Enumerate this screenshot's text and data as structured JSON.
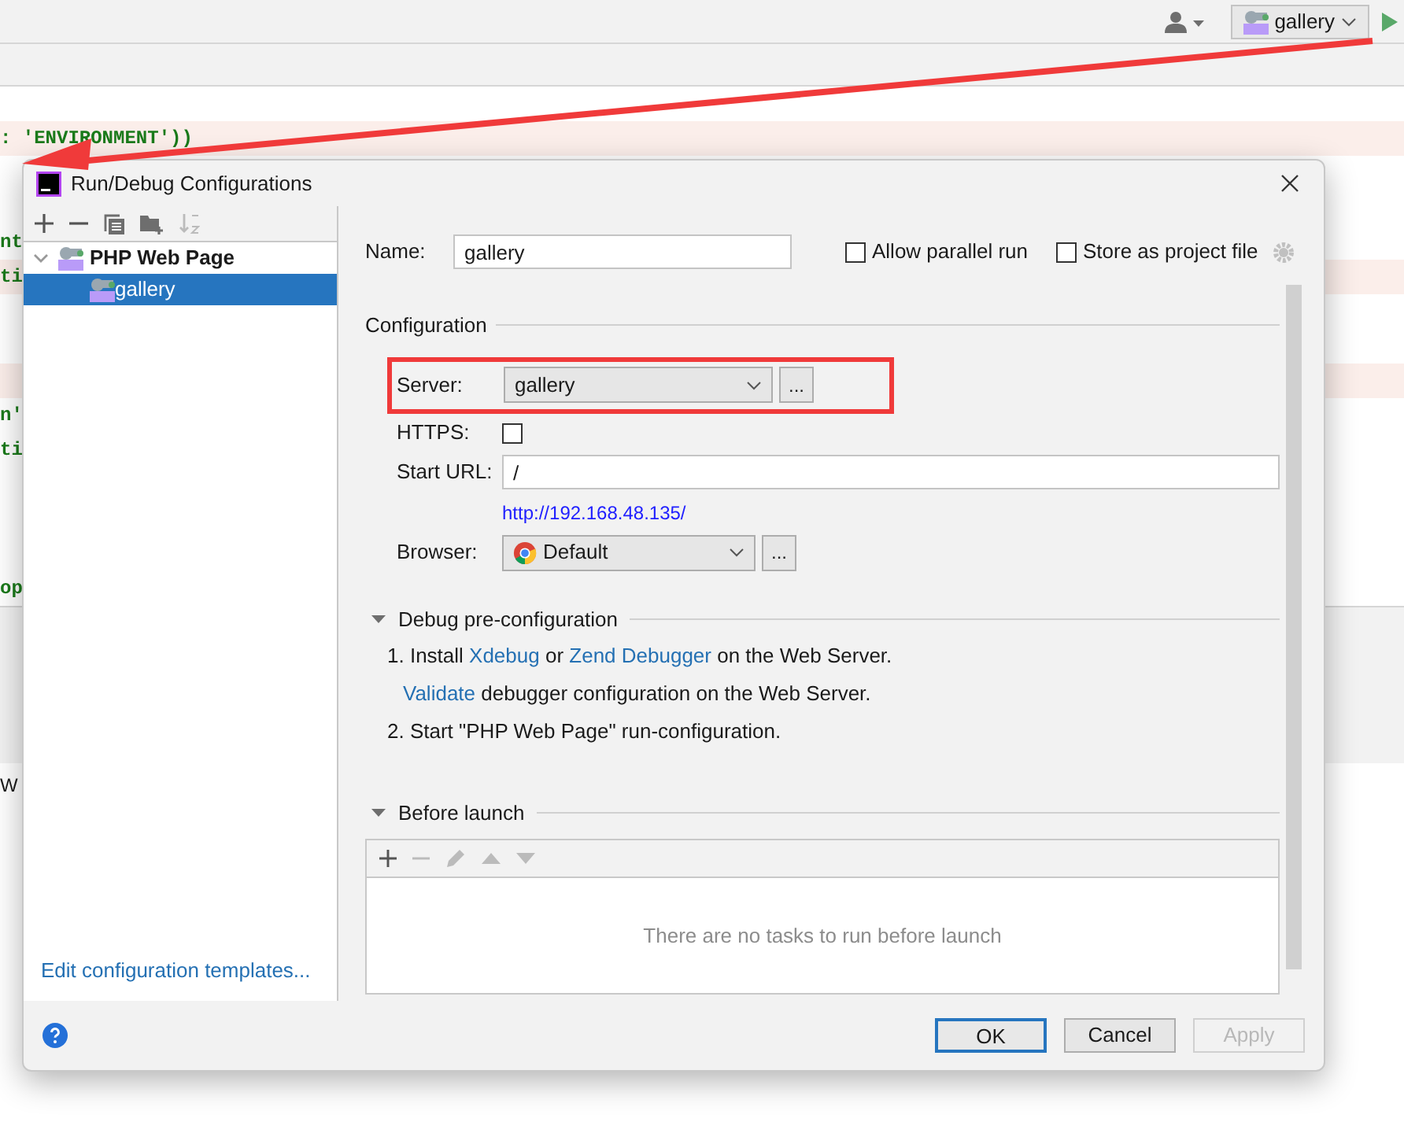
{
  "ide": {
    "run_config": "gallery",
    "code_lines": [
      {
        "highlight": false
      },
      {
        "text": ": 'ENVIRONMENT'))",
        "highlight": true
      },
      {
        "highlight": false
      },
      {
        "highlight": false
      },
      {
        "text": "nt",
        "highlight": false
      },
      {
        "text": "ti",
        "highlight": true
      },
      {
        "highlight": false
      },
      {
        "highlight": false
      },
      {
        "highlight": true
      },
      {
        "text": "n'",
        "highlight": false
      },
      {
        "text": "ti",
        "highlight": false
      },
      {
        "highlight": false
      },
      {
        "highlight": false
      },
      {
        "highlight": false
      },
      {
        "text": "op",
        "highlight": false
      }
    ],
    "status_text": "W"
  },
  "dialog": {
    "title": "Run/Debug Configurations",
    "tree": [
      {
        "label": "PHP Web Page",
        "expanded": true,
        "selected": false,
        "children": [
          {
            "label": "gallery",
            "selected": true
          }
        ]
      }
    ],
    "templates_link": "Edit configuration templates...",
    "name": {
      "label": "Name:",
      "value": "gallery"
    },
    "allow_parallel": {
      "label": "Allow parallel run",
      "checked": false
    },
    "store_project": {
      "label": "Store as project file",
      "checked": false
    },
    "configuration": {
      "title": "Configuration",
      "server": {
        "label": "Server:",
        "value": "gallery",
        "more": "..."
      },
      "https": {
        "label": "HTTPS:",
        "checked": false
      },
      "start_url": {
        "label": "Start URL:",
        "value": "/"
      },
      "resolved_url": "http://192.168.48.135/",
      "browser": {
        "label": "Browser:",
        "value": "Default",
        "more": "..."
      }
    },
    "debug": {
      "title": "Debug pre-configuration",
      "expanded": true,
      "steps": [
        [
          {
            "kind": "text",
            "text": "1. Install "
          },
          {
            "kind": "link",
            "text": "Xdebug"
          },
          {
            "kind": "text",
            "text": " or "
          },
          {
            "kind": "link",
            "text": "Zend Debugger"
          },
          {
            "kind": "text",
            "text": " on the Web Server."
          }
        ],
        [
          {
            "kind": "link",
            "text": "Validate"
          },
          {
            "kind": "text",
            "text": " debugger configuration on the Web Server."
          }
        ],
        [
          {
            "kind": "text",
            "text": "2. Start \"PHP Web Page\" run-configuration."
          }
        ]
      ]
    },
    "before_launch": {
      "title": "Before launch",
      "expanded": true,
      "empty_text": "There are no tasks to run before launch"
    },
    "buttons": [
      {
        "label": "OK",
        "kind": "default",
        "disabled": false
      },
      {
        "label": "Cancel",
        "kind": "normal",
        "disabled": false
      },
      {
        "label": "Apply",
        "kind": "normal",
        "disabled": true
      }
    ]
  }
}
